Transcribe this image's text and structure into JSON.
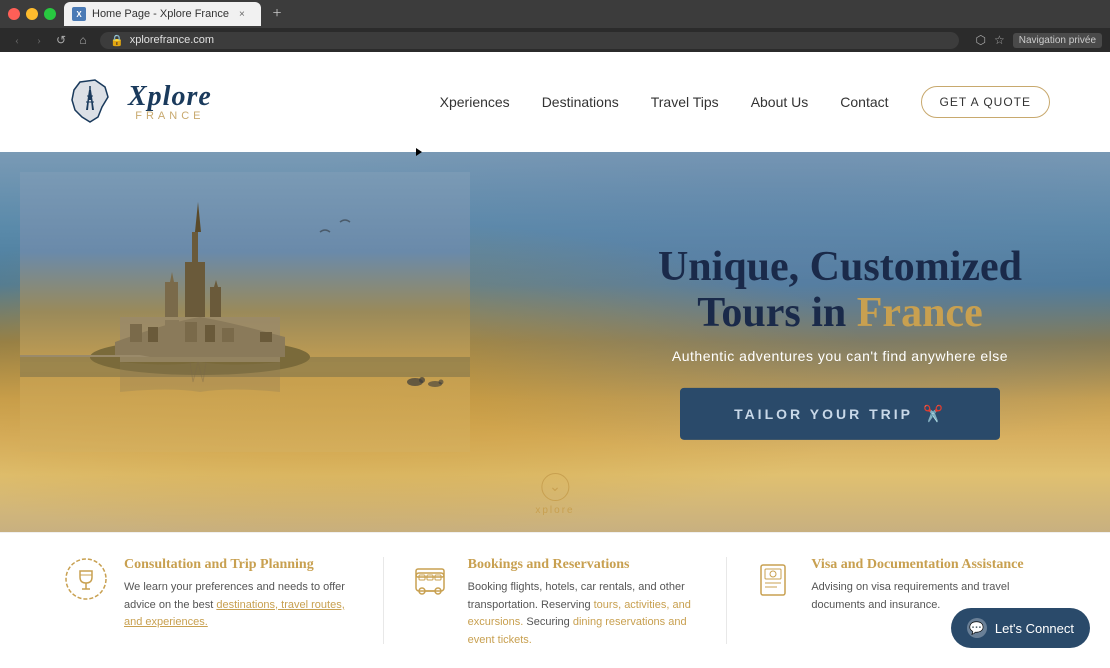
{
  "browser": {
    "tab_title": "Home Page - Xplore France",
    "tab_favicon_letter": "X",
    "new_tab_icon": "+",
    "url": "xplorefrance.com",
    "nav_back": "‹",
    "nav_forward": "›",
    "nav_refresh": "↺",
    "nav_home": "⌂",
    "nav_privee_label": "Navigation privée",
    "window_controls": {
      "minimize": "—",
      "maximize": "□",
      "close": "×"
    }
  },
  "navbar": {
    "logo_xplore": "Xplore",
    "logo_france": "FRANCE",
    "links": [
      {
        "label": "Xperiences",
        "id": "nav-xperiences"
      },
      {
        "label": "Destinations",
        "id": "nav-destinations"
      },
      {
        "label": "Travel Tips",
        "id": "nav-travel-tips"
      },
      {
        "label": "About Us",
        "id": "nav-about"
      },
      {
        "label": "Contact",
        "id": "nav-contact"
      }
    ],
    "cta_label": "GET A QUOTE"
  },
  "hero": {
    "title_line1": "Unique, Customized",
    "title_line2_part1": "Tours in ",
    "title_line2_part2": "France",
    "subtitle": "Authentic adventures you can't find anywhere else",
    "cta_label": "TAILOR YOUR TRIP",
    "cta_icon": "✂",
    "scroll_label": "xplore"
  },
  "services": [
    {
      "id": "consultation",
      "icon": "🍷",
      "title": "Consultation and Trip Planning",
      "description": "We learn your preferences and needs to offer advice on the best destinations, travel routes, and experiences.",
      "link_text": "destinations, travel routes, and experiences."
    },
    {
      "id": "bookings",
      "icon": "🚌",
      "title": "Bookings and Reservations",
      "description": "Booking flights, hotels, car rentals, and other transportation. Reserving tours, activities, and excursions. Securing dining reservations and event tickets."
    },
    {
      "id": "visa",
      "icon": "📄",
      "title": "Visa and Documentation Assistance",
      "description": "Advising on visa requirements and travel documents and insurance."
    }
  ],
  "chat": {
    "label": "Let's Connect"
  },
  "colors": {
    "brand_dark": "#1a2a4a",
    "brand_gold": "#c8a050",
    "nav_blue": "#2a4a6a",
    "text_dark": "#333"
  }
}
